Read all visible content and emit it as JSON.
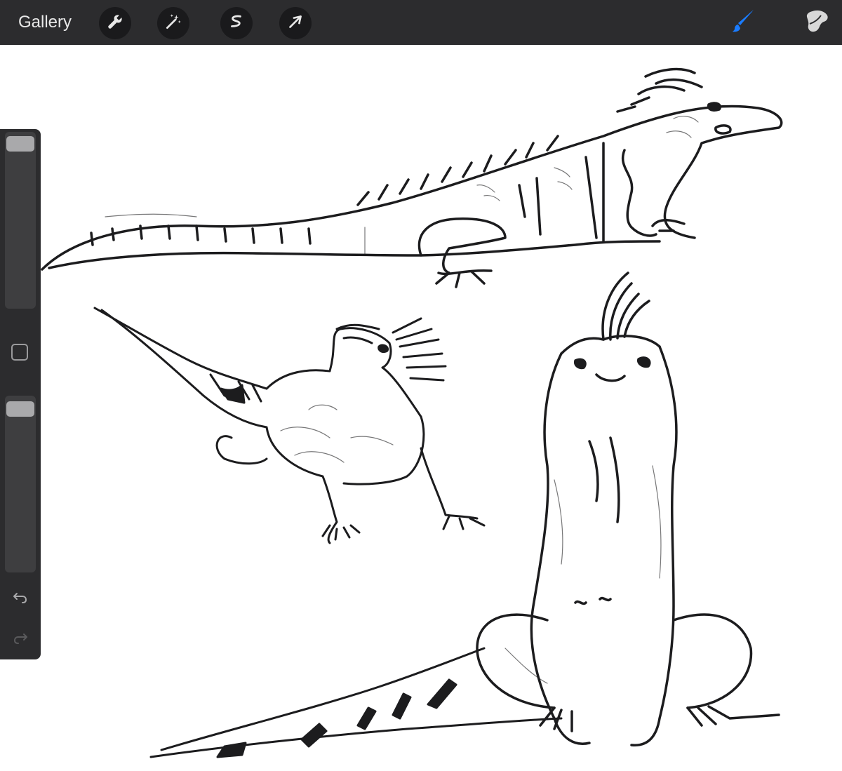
{
  "topbar": {
    "gallery_label": "Gallery",
    "left_tools": [
      {
        "icon": "wrench-icon"
      },
      {
        "icon": "magic-wand-icon"
      },
      {
        "icon": "selection-icon"
      },
      {
        "icon": "transform-arrow-icon"
      }
    ],
    "right_tools": [
      {
        "icon": "brush-icon",
        "active": true
      },
      {
        "icon": "smudge-icon",
        "active": false
      }
    ]
  },
  "sidebar": {
    "brush_size": {
      "icon": "brush-size-slider"
    },
    "opacity": {
      "icon": "opacity-slider"
    },
    "undo_icon": "undo-icon",
    "redo_icon": "redo-icon"
  },
  "colors": {
    "toolbar": "#2c2c2e",
    "accent": "#1a7cff",
    "ink": "#1c1c1e"
  }
}
